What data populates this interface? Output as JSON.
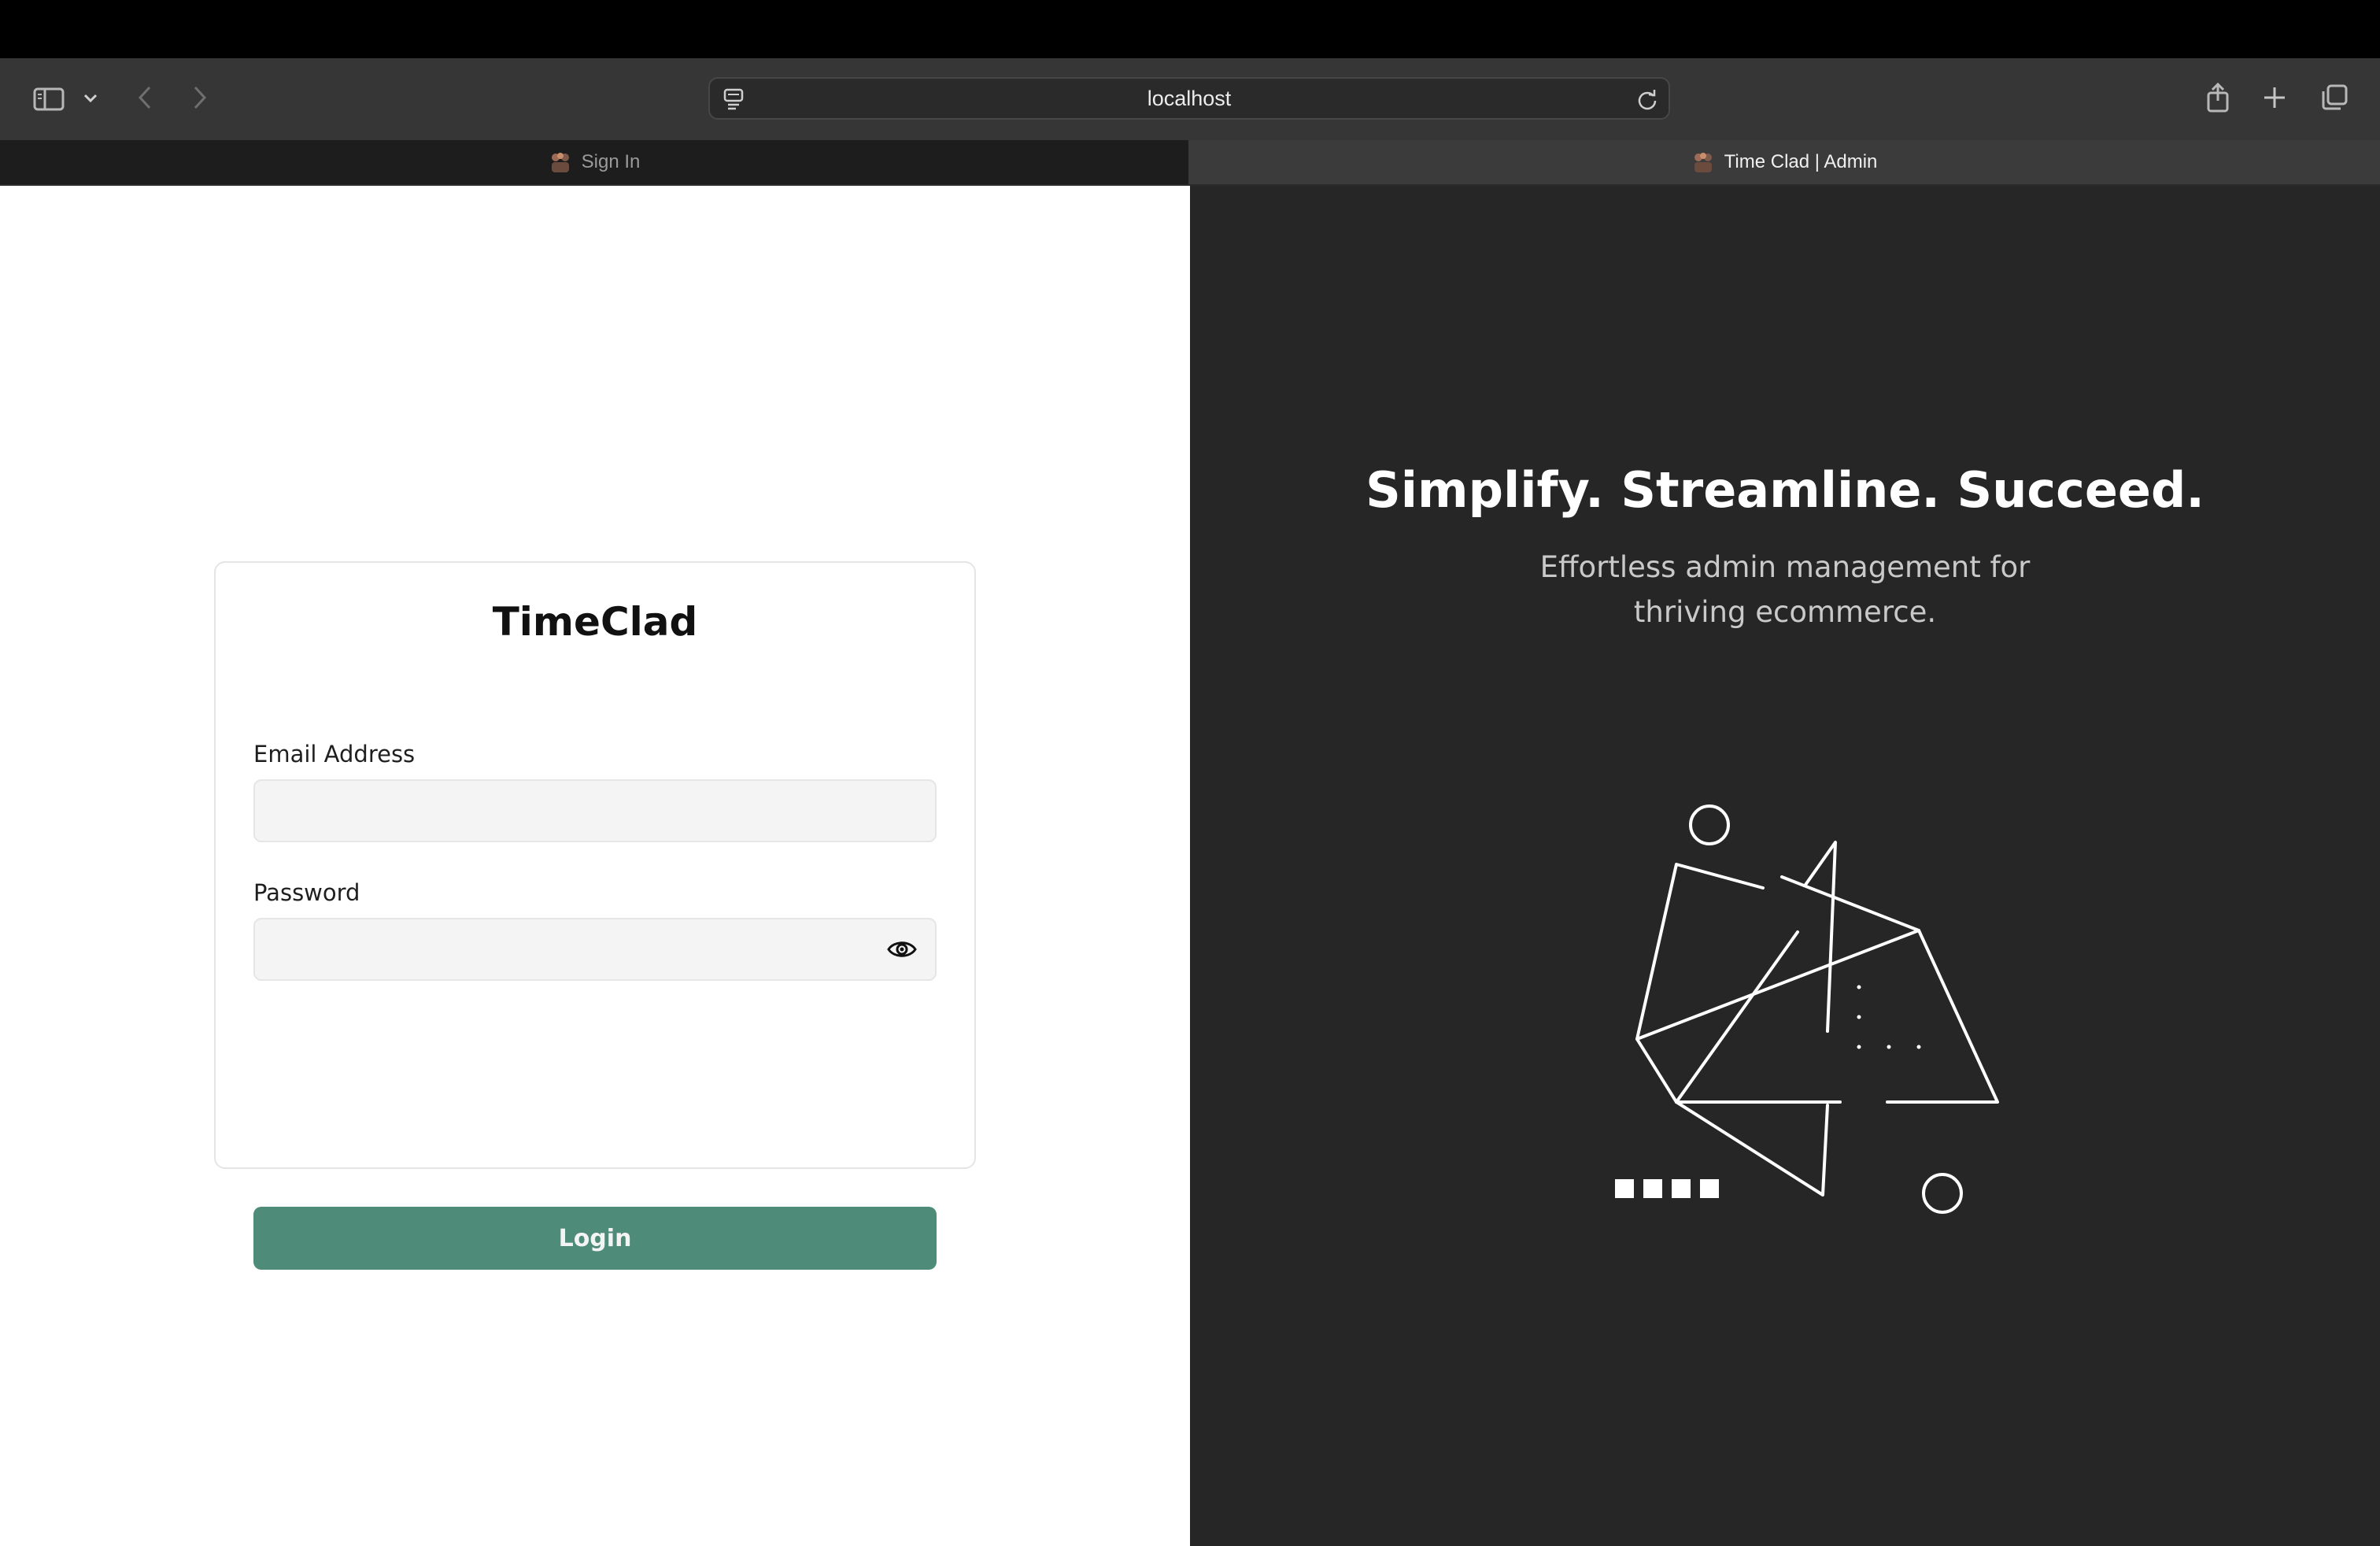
{
  "browser": {
    "url": "localhost",
    "tabs": [
      {
        "label": "Sign In",
        "active": false
      },
      {
        "label": "Time Clad | Admin",
        "active": true
      }
    ],
    "icons": [
      "sidebar-icon",
      "chevron-down-icon",
      "back-icon",
      "forward-icon",
      "site-settings-icon",
      "reload-icon",
      "share-icon",
      "new-tab-icon",
      "tab-overview-icon"
    ]
  },
  "login": {
    "brand": "TimeClad",
    "email_label": "Email Address",
    "email_value": "",
    "password_label": "Password",
    "password_value": "",
    "login_label": "Login",
    "button_color": "#4e8b78"
  },
  "hero": {
    "headline": "Simplify. Streamline. Succeed.",
    "subline_1": "Effortless admin management for",
    "subline_2": "thriving ecommerce.",
    "background": "#262626"
  }
}
